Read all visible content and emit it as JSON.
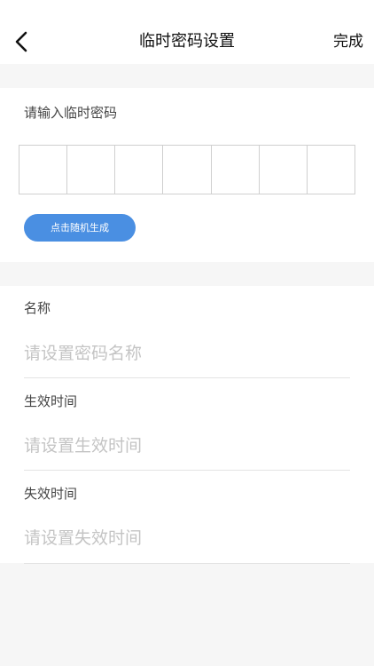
{
  "header": {
    "title": "临时密码设置",
    "done_label": "完成"
  },
  "password": {
    "prompt": "请输入临时密码",
    "digits": [
      "",
      "",
      "",
      "",
      "",
      "",
      ""
    ],
    "random_button_label": "点击随机生成"
  },
  "fields": {
    "name": {
      "label": "名称",
      "value": "",
      "placeholder": "请设置密码名称"
    },
    "start_time": {
      "label": "生效时间",
      "value": "",
      "placeholder": "请设置生效时间"
    },
    "end_time": {
      "label": "失效时间",
      "value": "",
      "placeholder": "请设置失效时间"
    }
  },
  "colors": {
    "accent": "#4a8fe2",
    "background": "#f6f6f6",
    "card": "#ffffff",
    "placeholder": "#c4c4c4"
  }
}
